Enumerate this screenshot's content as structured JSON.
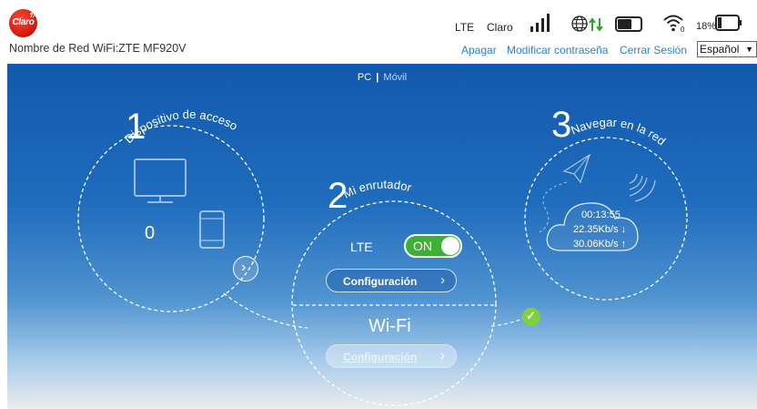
{
  "header": {
    "logo_text": "Claro",
    "network_name": "Nombre de Red WiFi:ZTE MF920V",
    "network_type": "LTE",
    "carrier": "Claro",
    "battery_percent": "18%",
    "links": {
      "shutdown": "Apagar",
      "change_password": "Modificar contraseña",
      "logout": "Cerrar Sesión"
    },
    "language": "Español",
    "icons": [
      "signal-bars-icon",
      "globe-data-icon",
      "sim-icon",
      "wifi-icon",
      "battery-icon"
    ]
  },
  "mode_switch": {
    "pc": "PC",
    "separator": "|",
    "mobile": "Móvil"
  },
  "steps": {
    "step1": {
      "number": "1",
      "title": "Dispositivo de acceso",
      "connected_count": "0"
    },
    "step2": {
      "number": "2",
      "title": "Mi enrutador",
      "lte_label": "LTE",
      "lte_toggle": "ON",
      "lte_config": "Configuración",
      "wifi_label": "Wi-Fi",
      "wifi_config": "Configuración"
    },
    "step3": {
      "number": "3",
      "title": "Navegar en la red",
      "duration": "00:13:55",
      "download": "22.35Kb/s ↓",
      "upload": "30.06Kb/s ↑"
    }
  },
  "colors": {
    "brand_red": "#e0261a",
    "link_blue": "#2a7ed6",
    "toggle_green": "#3fb036",
    "check_green": "#7fd13a"
  }
}
